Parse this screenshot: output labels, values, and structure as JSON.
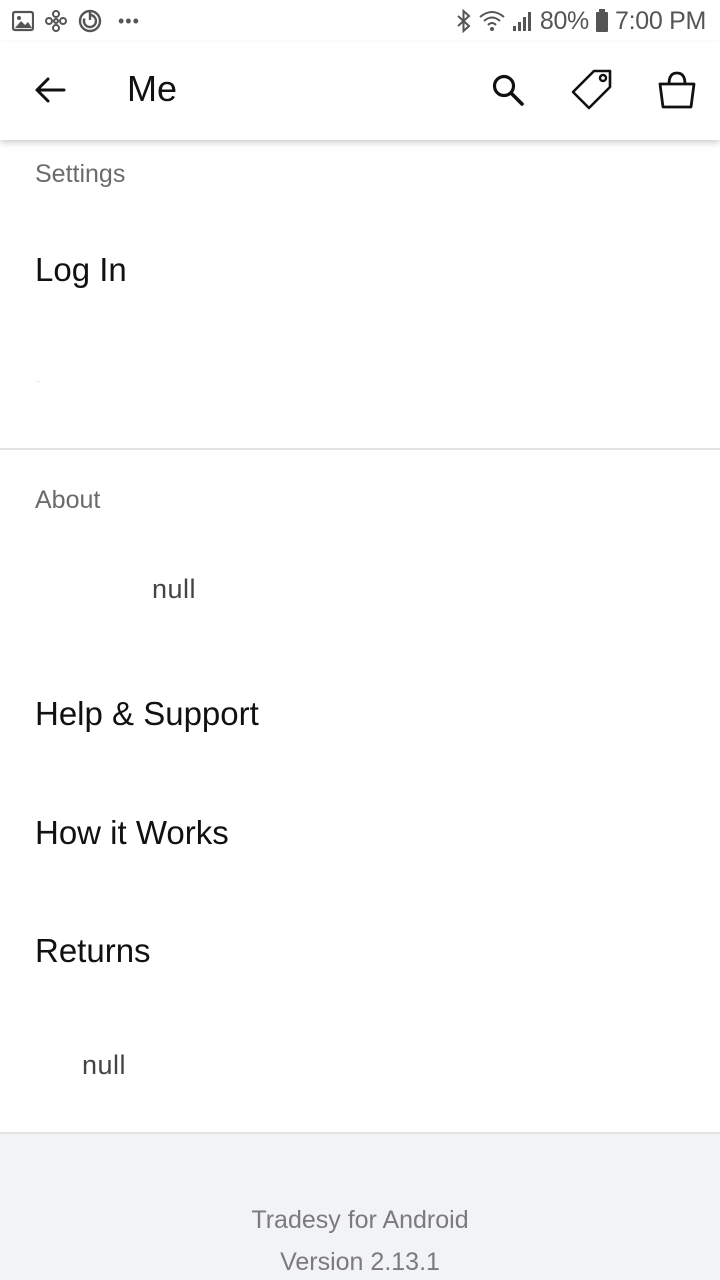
{
  "status_bar": {
    "battery": "80%",
    "time": "7:00 PM",
    "overflow": "•••",
    "left_icons": [
      "image-icon",
      "pinwheel-icon",
      "sync-icon"
    ],
    "right_icons": [
      "bluetooth-icon",
      "wifi-icon",
      "signal-icon",
      "battery-icon"
    ]
  },
  "app_bar": {
    "title": "Me",
    "icons": [
      "back-arrow-icon",
      "search-icon",
      "tag-icon",
      "shopping-bag-icon"
    ]
  },
  "settings": {
    "header": "Settings",
    "items": [
      "Log In"
    ]
  },
  "about": {
    "header": "About",
    "null_top": "null",
    "items": [
      "Help & Support",
      "How it Works",
      "Returns"
    ],
    "null_bottom": "null"
  },
  "footer": {
    "app_name": "Tradesy for Android",
    "version": "Version 2.13.1"
  },
  "colors": {
    "background": "#ffffff",
    "footer_bg": "#f2f3f6",
    "divider": "#e3e3e3",
    "section_header": "#6b6b6b",
    "text": "#111111"
  }
}
